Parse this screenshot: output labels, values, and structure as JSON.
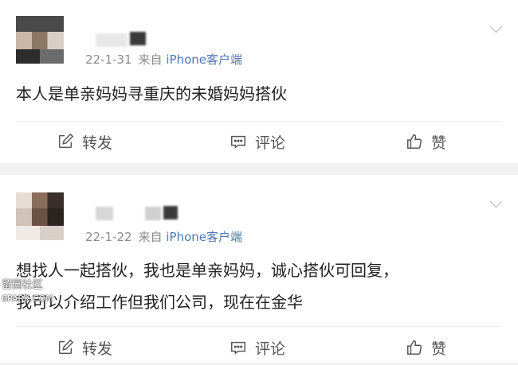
{
  "posts": [
    {
      "date": "22-1-31",
      "source_prefix": "来自",
      "source": "iPhone客户端",
      "text_lines": [
        "本人是单亲妈妈寻重庆的未婚妈妈搭伙"
      ],
      "actions": {
        "repost": "转发",
        "comment": "评论",
        "like": "赞"
      }
    },
    {
      "date": "22-1-22",
      "source_prefix": "来自",
      "source": "iPhone客户端",
      "text_lines": [
        "想找人一起搭伙，我也是单亲妈妈，诚心搭伙可回复，",
        "我可以介绍工作但我们公司，现在在金华"
      ],
      "actions": {
        "repost": "转发",
        "comment": "评论",
        "like": "赞"
      }
    }
  ],
  "watermark": {
    "line1": "留园社区",
    "line2": "6PARK.COM"
  },
  "colors": {
    "link": "#4a78b5",
    "meta": "#8c8c8c",
    "separator": "#f2f2f2"
  },
  "icons": {
    "repost": "edit-square-icon",
    "comment": "comment-bubble-icon",
    "like": "thumbs-up-icon",
    "more": "chevron-down-icon"
  }
}
